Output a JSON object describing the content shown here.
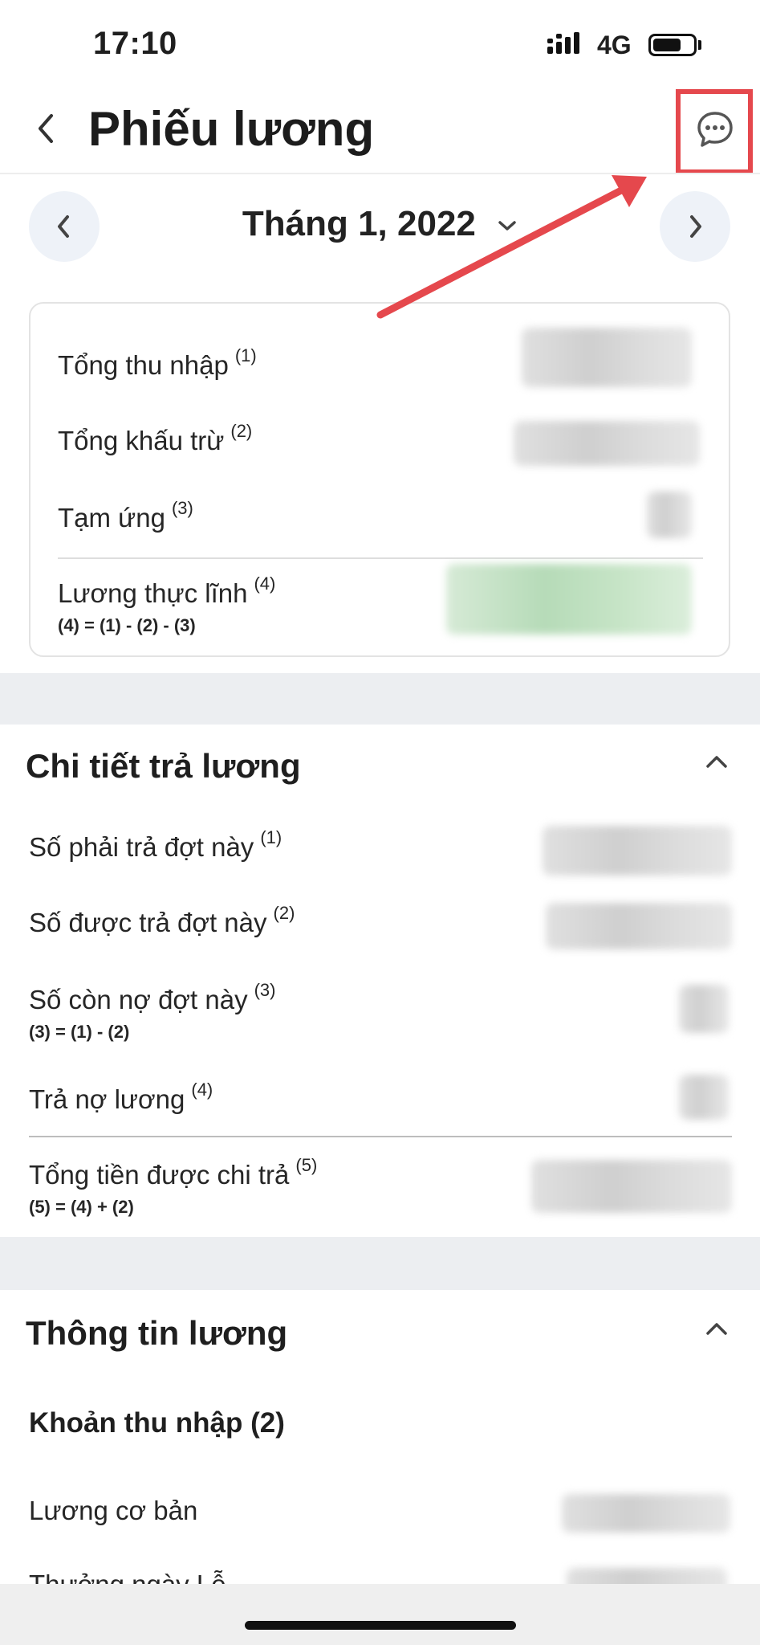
{
  "status_bar": {
    "time": "17:10",
    "network": "4G"
  },
  "header": {
    "title": "Phiếu lương",
    "back_icon": "chevron-left-icon",
    "chat_icon": "chat-bubble-dots-icon"
  },
  "month_nav": {
    "label": "Tháng 1, 2022"
  },
  "summary": {
    "rows": [
      {
        "label": "Tổng thu nhập",
        "ref": "(1)"
      },
      {
        "label": "Tổng khấu trừ",
        "ref": "(2)"
      },
      {
        "label": "Tạm ứng",
        "ref": "(3)"
      },
      {
        "label": "Lương thực lĩnh",
        "ref": "(4)",
        "formula": "(4) = (1) - (2) - (3)"
      }
    ]
  },
  "payment_details": {
    "title": "Chi tiết trả lương",
    "rows": [
      {
        "label": "Số phải trả đợt này",
        "ref": "(1)"
      },
      {
        "label": "Số được trả đợt này",
        "ref": "(2)"
      },
      {
        "label": "Số còn nợ đợt này",
        "ref": "(3)",
        "formula": "(3) = (1) - (2)"
      },
      {
        "label": "Trả nợ lương",
        "ref": "(4)"
      },
      {
        "label": "Tổng tiền được chi trả",
        "ref": "(5)",
        "formula": "(5) = (4) + (2)"
      }
    ]
  },
  "salary_info": {
    "title": "Thông tin lương",
    "income_heading": "Khoản thu nhập (2)",
    "rows": [
      {
        "label": "Lương cơ bản"
      },
      {
        "label": "Thưởng ngày Lễ"
      }
    ]
  },
  "colors": {
    "highlight": "#e5484d",
    "green_value": "#b6dbb8",
    "section_gap": "#eceef1"
  }
}
